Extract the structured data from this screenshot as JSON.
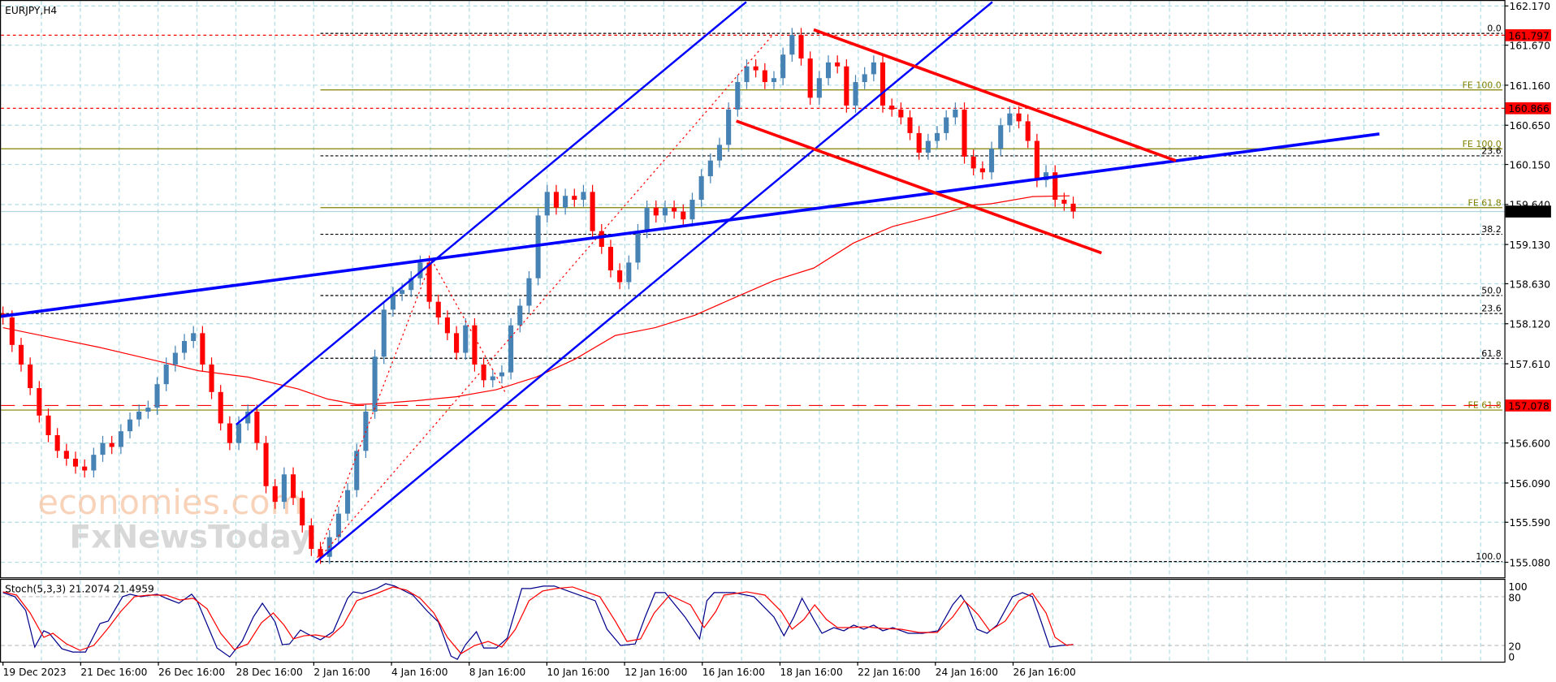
{
  "header": {
    "symbol_timeframe": "EURJPY,H4"
  },
  "watermark": {
    "line1": "economies.com",
    "line2": "FxNewsToday"
  },
  "colors": {
    "bull": "#4682B4",
    "bear": "#FF0000",
    "ma": "#FF0000",
    "stoch_main": "#00008B",
    "stoch_signal": "#FF0000",
    "grid": "#B0DDE4",
    "fib": "#000000",
    "fe": "#808000",
    "trend_blue": "#0000FF",
    "trend_red": "#FF0000"
  },
  "chart_data": {
    "type": "candlestick",
    "title": "EURJPY,H4",
    "ylim": [
      155.08,
      162.17
    ],
    "y_ticks": [
      "162.170",
      "161.670",
      "161.160",
      "160.650",
      "160.150",
      "159.640",
      "159.130",
      "158.630",
      "158.120",
      "157.610",
      "156.600",
      "156.090",
      "155.590",
      "155.080"
    ],
    "y_tick_values": [
      162.17,
      161.67,
      161.16,
      160.65,
      160.15,
      159.64,
      159.13,
      158.63,
      158.12,
      157.61,
      156.6,
      156.09,
      155.59,
      155.08
    ],
    "x_labels": [
      "19 Dec 2023",
      "21 Dec 16:00",
      "26 Dec 16:00",
      "28 Dec 16:00",
      "2 Jan 16:00",
      "4 Jan 16:00",
      "8 Jan 16:00",
      "10 Jan 16:00",
      "12 Jan 16:00",
      "16 Jan 16:00",
      "18 Jan 16:00",
      "22 Jan 16:00",
      "24 Jan 16:00",
      "26 Jan 16:00"
    ],
    "closes": [
      158.2,
      157.85,
      157.6,
      157.3,
      156.95,
      156.7,
      156.5,
      156.4,
      156.3,
      156.25,
      156.45,
      156.6,
      156.55,
      156.75,
      156.9,
      157.0,
      157.05,
      157.35,
      157.6,
      157.75,
      157.9,
      158.0,
      157.6,
      157.25,
      156.85,
      156.6,
      156.85,
      157.0,
      156.6,
      156.05,
      155.85,
      156.2,
      155.9,
      155.55,
      155.25,
      155.15,
      155.4,
      155.7,
      156.0,
      156.5,
      157.0,
      157.7,
      158.3,
      158.5,
      158.55,
      158.7,
      158.9,
      158.4,
      158.2,
      158.0,
      157.75,
      158.1,
      157.6,
      157.4,
      157.45,
      157.5,
      158.1,
      158.35,
      158.7,
      159.5,
      159.8,
      159.6,
      159.75,
      159.7,
      159.8,
      159.3,
      159.1,
      158.8,
      158.65,
      158.9,
      159.3,
      159.6,
      159.5,
      159.6,
      159.55,
      159.45,
      159.7,
      160.0,
      160.2,
      160.4,
      160.85,
      161.2,
      161.4,
      161.35,
      161.2,
      161.25,
      161.55,
      161.8,
      161.5,
      161.0,
      161.25,
      161.45,
      161.4,
      160.9,
      161.2,
      161.3,
      161.45,
      160.9,
      160.85,
      160.75,
      160.55,
      160.3,
      160.45,
      160.55,
      160.75,
      160.85,
      160.25,
      160.1,
      160.05,
      160.35,
      160.65,
      160.8,
      160.7,
      160.45,
      159.95,
      160.05,
      159.7,
      159.65,
      159.55
    ],
    "moving_average": [
      [
        0,
        158.07
      ],
      [
        5.1,
        157.95
      ],
      [
        10.6,
        157.82
      ],
      [
        16.1,
        157.67
      ],
      [
        21.6,
        157.52
      ],
      [
        27,
        157.44
      ],
      [
        32.5,
        157.29
      ],
      [
        35.8,
        157.16
      ],
      [
        39,
        157.09
      ],
      [
        41.2,
        157.1
      ],
      [
        45.6,
        157.14
      ],
      [
        50,
        157.19
      ],
      [
        54.4,
        157.28
      ],
      [
        58.8,
        157.44
      ],
      [
        63.1,
        157.67
      ],
      [
        67.5,
        157.97
      ],
      [
        71.9,
        158.07
      ],
      [
        76.3,
        158.23
      ],
      [
        80.6,
        158.45
      ],
      [
        85,
        158.67
      ],
      [
        89.4,
        158.83
      ],
      [
        93.8,
        159.15
      ],
      [
        98.1,
        159.36
      ],
      [
        102.5,
        159.49
      ],
      [
        106.9,
        159.63
      ],
      [
        109,
        159.65
      ],
      [
        113.5,
        159.74
      ],
      [
        117.6,
        159.75
      ]
    ],
    "price_markers": [
      {
        "label": "161.797",
        "price": 161.797,
        "color": "#FF0000",
        "style": "dash"
      },
      {
        "label": "160.866",
        "price": 160.866,
        "color": "#FF0000",
        "style": "dash"
      },
      {
        "label": "157.078",
        "price": 157.078,
        "color": "#FF0000",
        "style": "longdash"
      },
      {
        "label": "159.550",
        "price": 159.55,
        "color": "#000000",
        "style": "current"
      }
    ],
    "levels": [
      {
        "label": "0.0",
        "price": 161.82,
        "kind": "fib",
        "start_bar": 35
      },
      {
        "label": "FE 100.0",
        "price": 161.1,
        "kind": "fe",
        "start_bar": 35
      },
      {
        "label": "FE 100.0",
        "price": 160.35,
        "kind": "fe",
        "start_bar": 0
      },
      {
        "label": "23.6",
        "price": 160.26,
        "kind": "fib",
        "start_bar": 35
      },
      {
        "label": "FE 61.8",
        "price": 159.6,
        "kind": "fe",
        "start_bar": 35
      },
      {
        "label": "38.2",
        "price": 159.26,
        "kind": "fib",
        "start_bar": 35
      },
      {
        "label": "50.0",
        "price": 158.48,
        "kind": "fib",
        "start_bar": 35
      },
      {
        "label": "23.6",
        "price": 158.25,
        "kind": "fib",
        "start_bar": 0
      },
      {
        "label": "61.8",
        "price": 157.68,
        "kind": "fib",
        "start_bar": 35
      },
      {
        "label": "FE 61.8",
        "price": 157.02,
        "kind": "fe",
        "start_bar": 0
      },
      {
        "label": "100.0",
        "price": 155.09,
        "kind": "fib",
        "start_bar": 35
      }
    ],
    "stochastic": {
      "label": "Stoch(5,3,3) 21.2074 21.4959",
      "ylim": [
        0,
        100
      ],
      "y_ticks": [
        "100",
        "80",
        "20",
        "0"
      ],
      "y_tick_values": [
        100,
        80,
        20,
        0
      ],
      "main": [
        [
          0,
          85
        ],
        [
          1.3,
          80
        ],
        [
          2.5,
          63
        ],
        [
          3.5,
          18
        ],
        [
          4.5,
          38
        ],
        [
          5.1,
          35
        ],
        [
          6.5,
          16
        ],
        [
          7.7,
          12
        ],
        [
          9.1,
          12
        ],
        [
          10.7,
          47
        ],
        [
          11.6,
          50
        ],
        [
          13.2,
          80
        ],
        [
          14,
          83
        ],
        [
          15.2,
          80
        ],
        [
          17,
          83
        ],
        [
          18,
          78
        ],
        [
          19.4,
          72
        ],
        [
          20.8,
          83
        ],
        [
          21.4,
          75
        ],
        [
          23.6,
          17
        ],
        [
          25,
          6
        ],
        [
          26.4,
          26
        ],
        [
          27.6,
          55
        ],
        [
          28.6,
          72
        ],
        [
          30,
          49
        ],
        [
          30.8,
          21
        ],
        [
          31.6,
          22
        ],
        [
          32.8,
          39
        ],
        [
          33.6,
          34
        ],
        [
          35,
          27
        ],
        [
          36.4,
          37
        ],
        [
          38,
          78
        ],
        [
          38.6,
          86
        ],
        [
          39.6,
          84
        ],
        [
          41.2,
          90
        ],
        [
          42.2,
          96
        ],
        [
          43.2,
          93
        ],
        [
          45.2,
          82
        ],
        [
          46.8,
          62
        ],
        [
          48,
          49
        ],
        [
          49.4,
          7
        ],
        [
          50.1,
          3
        ],
        [
          51,
          21
        ],
        [
          52.2,
          37
        ],
        [
          53,
          17
        ],
        [
          54.4,
          17
        ],
        [
          55.6,
          29
        ],
        [
          57.2,
          90
        ],
        [
          58.2,
          90
        ],
        [
          59.6,
          93
        ],
        [
          60.8,
          93
        ],
        [
          62.3,
          87
        ],
        [
          65.3,
          75
        ],
        [
          66.6,
          40
        ],
        [
          68.1,
          20
        ],
        [
          69.7,
          22
        ],
        [
          70.8,
          55
        ],
        [
          71.9,
          85
        ],
        [
          73,
          85
        ],
        [
          75.2,
          55
        ],
        [
          76.8,
          28
        ],
        [
          77.6,
          75
        ],
        [
          78.4,
          85
        ],
        [
          80.6,
          85
        ],
        [
          82.8,
          80
        ],
        [
          85,
          55
        ],
        [
          86.1,
          32
        ],
        [
          87.2,
          55
        ],
        [
          88.1,
          78
        ],
        [
          89.4,
          52
        ],
        [
          90.3,
          35
        ],
        [
          91.6,
          42
        ],
        [
          92.7,
          38
        ],
        [
          93.8,
          45
        ],
        [
          94.9,
          40
        ],
        [
          96,
          45
        ],
        [
          97,
          38
        ],
        [
          98.1,
          42
        ],
        [
          99.8,
          35
        ],
        [
          101.4,
          35
        ],
        [
          103.1,
          38
        ],
        [
          104.7,
          70
        ],
        [
          105.6,
          82
        ],
        [
          106.3,
          70
        ],
        [
          107.4,
          40
        ],
        [
          108.5,
          35
        ],
        [
          109.6,
          45
        ],
        [
          111.3,
          80
        ],
        [
          112.4,
          85
        ],
        [
          113.5,
          80
        ],
        [
          114.6,
          45
        ],
        [
          115.4,
          18
        ],
        [
          116.7,
          20
        ],
        [
          118,
          21.2
        ]
      ],
      "signal": [
        [
          0,
          86
        ],
        [
          1.5,
          82
        ],
        [
          3,
          60
        ],
        [
          4.5,
          30
        ],
        [
          5.5,
          35
        ],
        [
          7,
          22
        ],
        [
          8.5,
          14
        ],
        [
          10,
          20
        ],
        [
          11.5,
          40
        ],
        [
          13,
          62
        ],
        [
          14.5,
          80
        ],
        [
          16,
          82
        ],
        [
          18,
          82
        ],
        [
          19.5,
          76
        ],
        [
          21,
          78
        ],
        [
          22.5,
          65
        ],
        [
          24,
          35
        ],
        [
          25.5,
          15
        ],
        [
          27,
          22
        ],
        [
          28.5,
          48
        ],
        [
          29.8,
          60
        ],
        [
          31,
          45
        ],
        [
          32,
          28
        ],
        [
          33.2,
          32
        ],
        [
          34.5,
          33
        ],
        [
          36,
          30
        ],
        [
          37.5,
          45
        ],
        [
          39,
          75
        ],
        [
          41,
          83
        ],
        [
          43,
          92
        ],
        [
          44.5,
          88
        ],
        [
          46,
          78
        ],
        [
          47.5,
          60
        ],
        [
          49,
          30
        ],
        [
          50.5,
          10
        ],
        [
          52,
          20
        ],
        [
          53.5,
          25
        ],
        [
          55,
          18
        ],
        [
          56.5,
          40
        ],
        [
          58,
          75
        ],
        [
          59.5,
          87
        ],
        [
          61,
          90
        ],
        [
          62.8,
          92
        ],
        [
          65.8,
          80
        ],
        [
          67.5,
          50
        ],
        [
          68.8,
          25
        ],
        [
          70.3,
          28
        ],
        [
          71.8,
          60
        ],
        [
          73.5,
          82
        ],
        [
          75.8,
          70
        ],
        [
          77.3,
          42
        ],
        [
          78.6,
          62
        ],
        [
          79.5,
          82
        ],
        [
          82,
          86
        ],
        [
          84,
          82
        ],
        [
          85.8,
          62
        ],
        [
          87,
          40
        ],
        [
          88.3,
          52
        ],
        [
          89.5,
          70
        ],
        [
          90.8,
          52
        ],
        [
          92,
          42
        ],
        [
          93.5,
          42
        ],
        [
          95,
          43
        ],
        [
          97,
          41
        ],
        [
          99,
          40
        ],
        [
          101,
          36
        ],
        [
          103,
          36
        ],
        [
          104.7,
          55
        ],
        [
          106,
          75
        ],
        [
          107.5,
          58
        ],
        [
          108.8,
          38
        ],
        [
          110.5,
          50
        ],
        [
          112,
          75
        ],
        [
          113.5,
          84
        ],
        [
          115,
          60
        ],
        [
          116,
          30
        ],
        [
          117.3,
          20
        ],
        [
          118,
          21.5
        ]
      ]
    }
  }
}
